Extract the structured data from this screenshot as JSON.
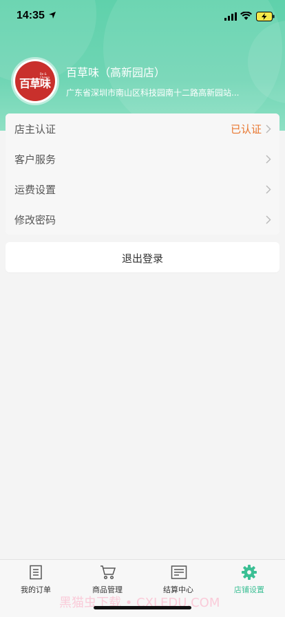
{
  "status_bar": {
    "time": "14:35",
    "icons": [
      "location-arrow-icon",
      "cellular-signal-icon",
      "wifi-icon",
      "battery-charging-icon"
    ]
  },
  "shop": {
    "name": "百草味（高新园店）",
    "address": "广东省深圳市南山区科技园南十二路高新园站...",
    "logo_text": "百草味",
    "logo_sub": "Be & Cheery"
  },
  "menu": [
    {
      "label": "店主认证",
      "status": "已认证"
    },
    {
      "label": "客户服务",
      "status": ""
    },
    {
      "label": "运费设置",
      "status": ""
    },
    {
      "label": "修改密码",
      "status": ""
    }
  ],
  "logout_label": "退出登录",
  "tabs": [
    {
      "label": "我的订单",
      "icon": "orders-icon",
      "active": false
    },
    {
      "label": "商品管理",
      "icon": "cart-icon",
      "active": false
    },
    {
      "label": "结算中心",
      "icon": "settlement-icon",
      "active": false
    },
    {
      "label": "店铺设置",
      "icon": "gear-icon",
      "active": true
    }
  ],
  "watermark": "黑猫虫下载 • CXLEDU.COM",
  "colors": {
    "header": "#6fd5b4",
    "accent": "#3bbf94",
    "status_orange": "#e8752d"
  }
}
